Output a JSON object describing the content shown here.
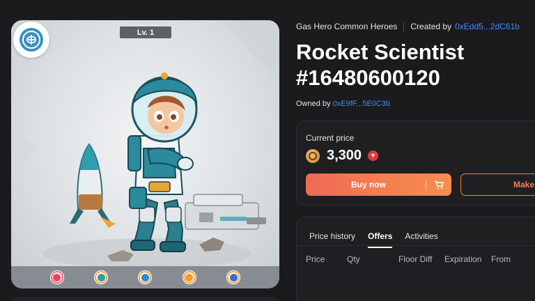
{
  "artwork": {
    "level_label": "Lv. 1",
    "emblem_icon": "brain-icon",
    "stat_icons": [
      {
        "name": "fire-stat-icon",
        "color": "#e8475a",
        "ring": "#f06a78"
      },
      {
        "name": "water-stat-icon",
        "color": "#2e9ea5",
        "ring": "#f3a447"
      },
      {
        "name": "shield-stat-icon",
        "color": "#2e8bd8",
        "ring": "#f3a447"
      },
      {
        "name": "lightning-stat-icon",
        "color": "#f39a2a",
        "ring": "#f3a447"
      },
      {
        "name": "wind-stat-icon",
        "color": "#2f6fd6",
        "ring": "#f3a447"
      }
    ]
  },
  "info": {
    "collection": "Gas Hero Common Heroes",
    "created_by_label": "Created by",
    "creator": "0xEdd5...2dC61b",
    "title_line1": "Rocket Scientist",
    "title_line2": "#16480600120",
    "owned_by_label": "Owned by",
    "owner": "0xE9fF...5E0C3b"
  },
  "price": {
    "label": "Current price",
    "value": "3,300",
    "currency_icon": "gmt-coin-icon",
    "chain_icon": "chain-badge-icon",
    "buy_label": "Buy now",
    "cart_icon": "cart-icon",
    "offer_label": "Make"
  },
  "history": {
    "tabs": [
      "Price history",
      "Offers",
      "Activities"
    ],
    "active_tab": "Offers",
    "columns": [
      "Price",
      "Qty",
      "Floor Diff",
      "Expiration",
      "From"
    ]
  },
  "colors": {
    "background": "#1b1b1d",
    "accent": "#f4804f",
    "link": "#3d8bff"
  }
}
